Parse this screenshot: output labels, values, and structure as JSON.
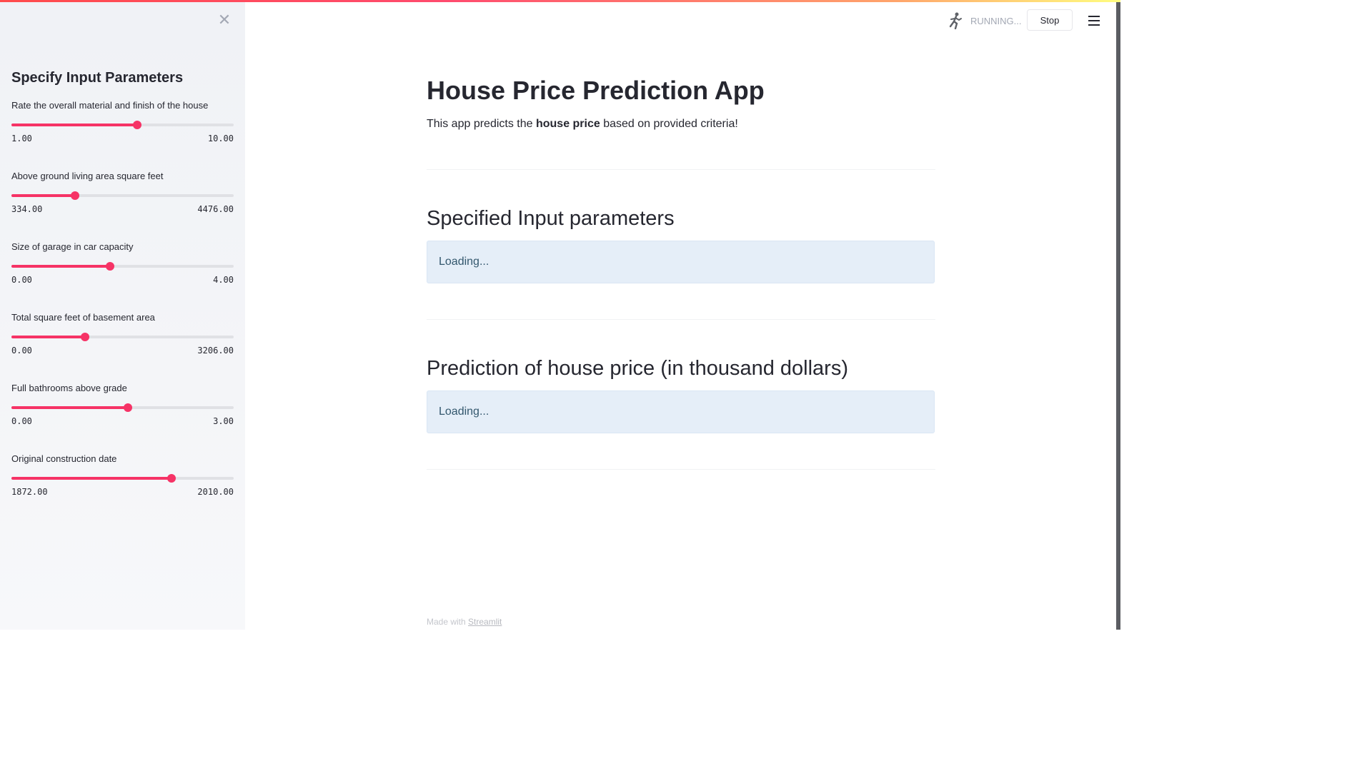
{
  "sidebar": {
    "close_icon": "close-icon",
    "title": "Specify Input Parameters",
    "sliders": [
      {
        "label": "Rate the overall material and finish of the house",
        "min": "1.00",
        "max": "10.00",
        "fraction": 0.567
      },
      {
        "label": "Above ground living area square feet",
        "min": "334.00",
        "max": "4476.00",
        "fraction": 0.285
      },
      {
        "label": "Size of garage in car capacity",
        "min": "0.00",
        "max": "4.00",
        "fraction": 0.443
      },
      {
        "label": "Total square feet of basement area",
        "min": "0.00",
        "max": "3206.00",
        "fraction": 0.33
      },
      {
        "label": "Full bathrooms above grade",
        "min": "0.00",
        "max": "3.00",
        "fraction": 0.523
      },
      {
        "label": "Original construction date",
        "min": "1872.00",
        "max": "2010.00",
        "fraction": 0.72
      }
    ]
  },
  "header": {
    "status_text": "RUNNING...",
    "stop_label": "Stop",
    "menu_icon": "hamburger-menu-icon"
  },
  "main": {
    "title": "House Price Prediction App",
    "intro_before": "This app predicts the ",
    "intro_bold": "house price",
    "intro_after": " based on provided criteria!",
    "section1_title": "Specified Input parameters",
    "section1_box": "Loading...",
    "section2_title": "Prediction of house price (in thousand dollars)",
    "section2_box": "Loading..."
  },
  "footer": {
    "prefix": "Made with ",
    "link": "Streamlit"
  },
  "colors": {
    "accent": "#f63366",
    "sidebar_bg": "#f0f2f6",
    "info_bg": "#e5eef8"
  }
}
